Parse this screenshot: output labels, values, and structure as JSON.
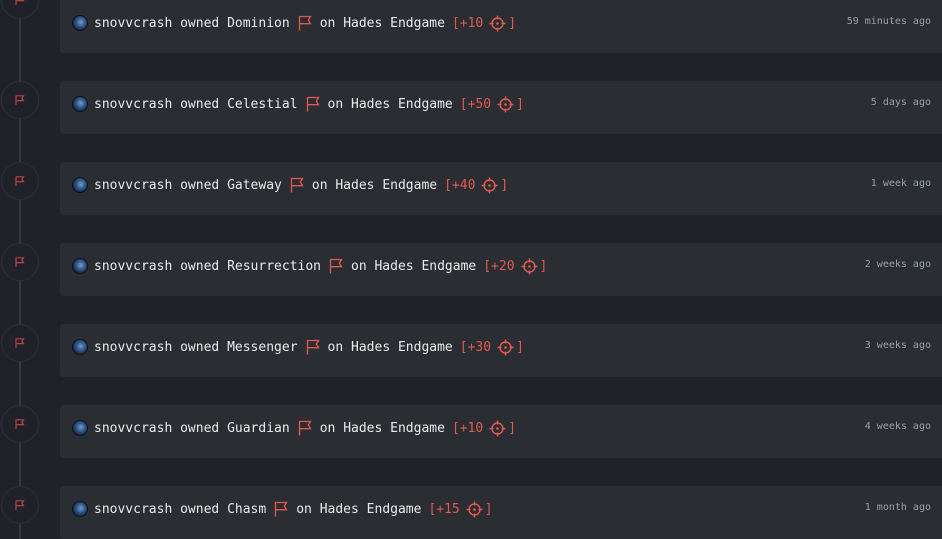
{
  "colors": {
    "background": "#1f2329",
    "card": "#2a2e33",
    "accent_red": "#e05a51",
    "text": "#eaeaea",
    "muted": "#9aa0a6"
  },
  "icons": {
    "node": "flag-icon",
    "inline": "flag-icon",
    "points": "crosshair-icon",
    "avatar": "user-avatar"
  },
  "feed": [
    {
      "user": "snovvcrash",
      "verb": "owned",
      "target": "Dominion",
      "on": "on",
      "event": "Hades Endgame",
      "points_open": "[+10",
      "points_close": "]",
      "time": "59 minutes ago"
    },
    {
      "user": "snovvcrash",
      "verb": "owned",
      "target": "Celestial",
      "on": "on",
      "event": "Hades Endgame",
      "points_open": "[+50",
      "points_close": "]",
      "time": "5 days ago"
    },
    {
      "user": "snovvcrash",
      "verb": "owned",
      "target": "Gateway",
      "on": "on",
      "event": "Hades Endgame",
      "points_open": "[+40",
      "points_close": "]",
      "time": "1 week ago"
    },
    {
      "user": "snovvcrash",
      "verb": "owned",
      "target": "Resurrection",
      "on": "on",
      "event": "Hades Endgame",
      "points_open": "[+20",
      "points_close": "]",
      "time": "2 weeks ago"
    },
    {
      "user": "snovvcrash",
      "verb": "owned",
      "target": "Messenger",
      "on": "on",
      "event": "Hades Endgame",
      "points_open": "[+30",
      "points_close": "]",
      "time": "3 weeks ago"
    },
    {
      "user": "snovvcrash",
      "verb": "owned",
      "target": "Guardian",
      "on": "on",
      "event": "Hades Endgame",
      "points_open": "[+10",
      "points_close": "]",
      "time": "4 weeks ago"
    },
    {
      "user": "snovvcrash",
      "verb": "owned",
      "target": "Chasm",
      "on": "on",
      "event": "Hades Endgame",
      "points_open": "[+15",
      "points_close": "]",
      "time": "1 month ago"
    }
  ]
}
